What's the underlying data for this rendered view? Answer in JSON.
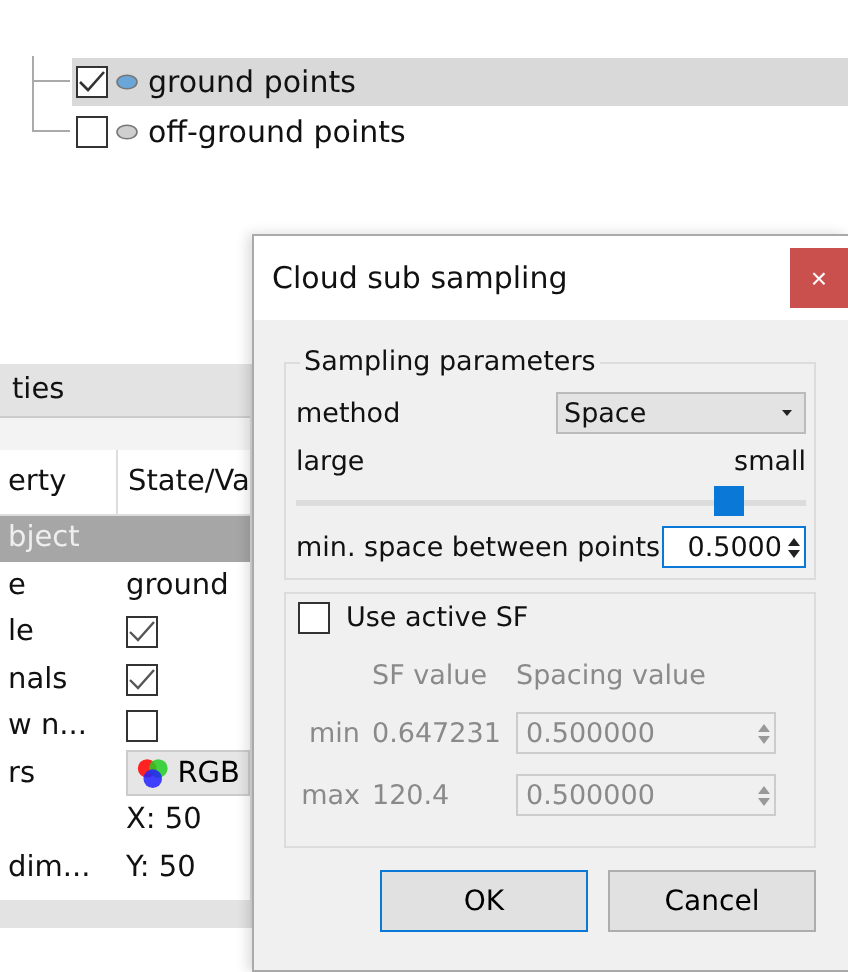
{
  "tree": {
    "items": [
      {
        "label": "ground points",
        "checked": true,
        "selected": true
      },
      {
        "label": "off-ground points",
        "checked": false,
        "selected": false
      }
    ]
  },
  "properties": {
    "title": "ties",
    "columns": [
      "erty",
      "State/Va"
    ],
    "group": "bject",
    "rows": [
      {
        "kind": "text",
        "name": "e",
        "value": "ground"
      },
      {
        "kind": "checkbox",
        "name": "le",
        "checked": true
      },
      {
        "kind": "checkbox",
        "name": "nals",
        "checked": true
      },
      {
        "kind": "checkbox",
        "name": "w n...",
        "checked": false
      },
      {
        "kind": "color_button",
        "name": "rs",
        "value": "RGB"
      },
      {
        "kind": "text",
        "name": "",
        "value": "X: 50"
      },
      {
        "kind": "text",
        "name": "dim...",
        "value": "Y: 50"
      }
    ]
  },
  "dialog": {
    "title": "Cloud sub sampling",
    "close": "×",
    "sampling": {
      "title": "Sampling parameters",
      "method_label": "method",
      "method": "Space",
      "large": "large",
      "small": "small",
      "level": 0.85,
      "spacing_label": "min. space between points",
      "spacing": "0.5000"
    },
    "sf": {
      "label": "Use active SF",
      "checked": false,
      "headers": [
        "SF value",
        "Spacing value"
      ],
      "rows": [
        {
          "label": "min",
          "sf": "0.647231",
          "spacing": "0.500000"
        },
        {
          "label": "max",
          "sf": "120.4",
          "spacing": "0.500000"
        }
      ]
    },
    "buttons": [
      "OK",
      "Cancel"
    ]
  }
}
